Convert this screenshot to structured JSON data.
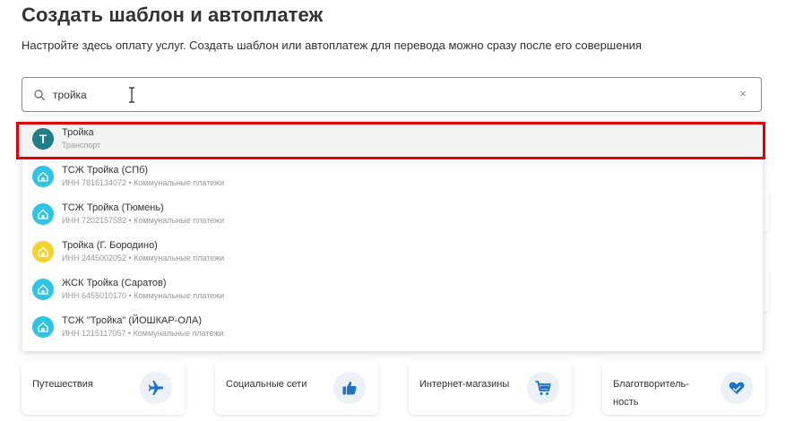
{
  "page": {
    "title": "Создать шаблон и автоплатеж",
    "subtitle": "Настройте здесь оплату услуг. Создать шаблон или автоплатеж для перевода можно сразу после его совершения"
  },
  "search": {
    "value": "тройка",
    "clear_symbol": "×"
  },
  "results": [
    {
      "name": "Тройка",
      "desc": "Транспорт",
      "avatar": "troika-logo-icon",
      "letter": "Т",
      "color": "#1e7f86"
    },
    {
      "name": "ТСЖ Тройка (СПб)",
      "desc": "ИНН 7816134072 • Коммунальные платежи",
      "avatar": "house-icon",
      "color": "#2ec4e6"
    },
    {
      "name": "ТСЖ Тройка (Тюмень)",
      "desc": "ИНН 7202157582 • Коммунальные платежи",
      "avatar": "house-icon",
      "color": "#2ec4e6"
    },
    {
      "name": "Тройка (Г. Бородино)",
      "desc": "ИНН 2445002052 • Коммунальные платежи",
      "avatar": "house-icon",
      "color": "#f6d22e"
    },
    {
      "name": "ЖСК Тройка (Саратов)",
      "desc": "ИНН 6455010170 • Коммунальные платежи",
      "avatar": "house-icon",
      "color": "#2ec4e6"
    },
    {
      "name": "ТСЖ \"Тройка\" (ЙОШКАР-ОЛА)",
      "desc": "ИНН 1215117057 • Коммунальные платежи",
      "avatar": "house-icon",
      "color": "#2ec4e6"
    }
  ],
  "categories": [
    {
      "label": "Путешествия",
      "icon": "airplane-icon"
    },
    {
      "label": "Социальные сети",
      "icon": "thumbs-up-icon"
    },
    {
      "label": "Интернет-магазины",
      "icon": "shopping-cart-icon"
    },
    {
      "label": "Благотворитель-ность",
      "icon": "heart-hands-icon"
    }
  ],
  "colors": {
    "accent": "#1a73c8",
    "highlight": "#e10000"
  }
}
